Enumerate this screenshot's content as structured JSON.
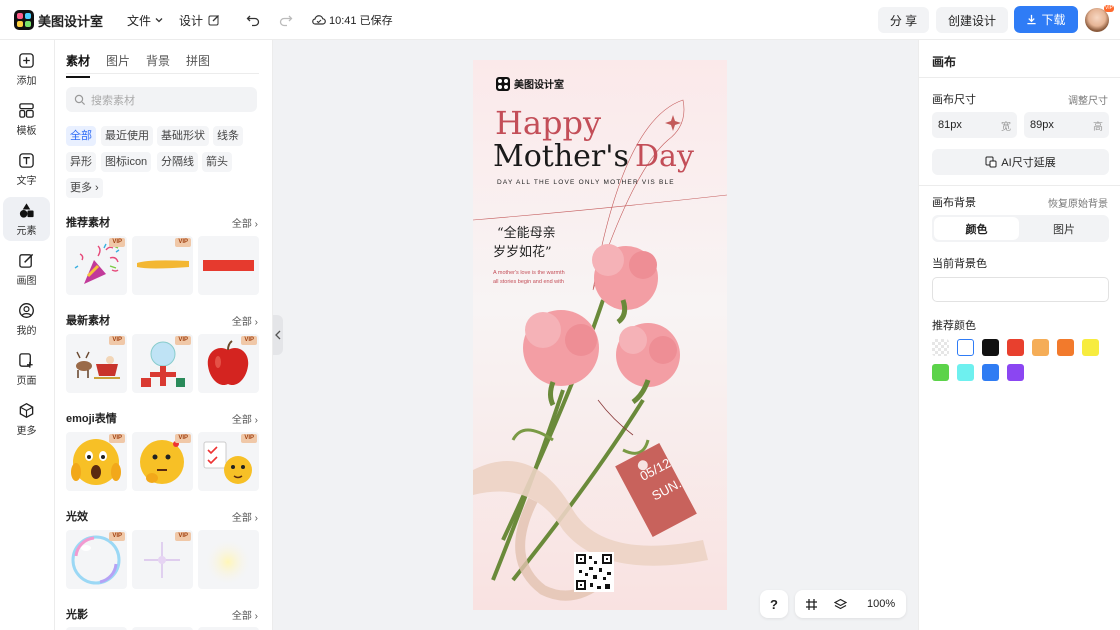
{
  "app": {
    "name": "美图设计室"
  },
  "topbar": {
    "menu_file": "文件",
    "menu_design": "设计",
    "save_status": "10:41 已保存",
    "share_label": "分 享",
    "create_label": "创建设计",
    "download_label": "下载",
    "avatar_badge": "VIP"
  },
  "leftnav": [
    {
      "label": "添加",
      "icon": "plus-square-icon"
    },
    {
      "label": "模板",
      "icon": "template-icon"
    },
    {
      "label": "文字",
      "icon": "text-icon"
    },
    {
      "label": "元素",
      "icon": "shapes-icon"
    },
    {
      "label": "画图",
      "icon": "pen-icon"
    },
    {
      "label": "我的",
      "icon": "user-icon"
    },
    {
      "label": "页面",
      "icon": "page-add-icon"
    },
    {
      "label": "更多",
      "icon": "cube-icon"
    }
  ],
  "panel": {
    "tabs": [
      "素材",
      "图片",
      "背景",
      "拼图"
    ],
    "search_placeholder": "搜索素材",
    "chips": [
      "全部",
      "最近使用",
      "基础形状",
      "线条",
      "异形",
      "图标icon",
      "分隔线",
      "箭头",
      "更多"
    ],
    "all_label": "全部",
    "vip_label": "VIP",
    "sections": [
      {
        "title": "推荐素材"
      },
      {
        "title": "最新素材"
      },
      {
        "title": "emoji表情"
      },
      {
        "title": "光效"
      },
      {
        "title": "光影"
      }
    ]
  },
  "poster": {
    "brand": "美图设计室",
    "happy": "Happy",
    "mother": "Mother's",
    "day": "Day",
    "tagline": "DAY ALL THE LOVE ONLY MOTHER VIS BLE",
    "quote1": "“全能母亲",
    "quote2": "岁岁如花”",
    "small1": "A mother's love is the warmth",
    "small2": "all stories begin and end with",
    "tag_date": "05/12",
    "tag_day": "SUN."
  },
  "right": {
    "title": "画布",
    "size_label": "画布尺寸",
    "adjust_label": "调整尺寸",
    "width_value": "81px",
    "width_unit": "宽",
    "height_value": "89px",
    "height_unit": "高",
    "ai_extend": "AI尺寸延展",
    "bg_label": "画布背景",
    "restore_label": "恢复原始背景",
    "seg_color": "颜色",
    "seg_image": "图片",
    "current_bg_label": "当前背景色",
    "recommend_label": "推荐颜色",
    "swatches": [
      "transparent",
      "#ffffff",
      "#111111",
      "#e8402e",
      "#f5ad57",
      "#f27a2c",
      "#f7ec3f",
      "#5cd34a",
      "#6ef0ef",
      "#2f7cf3",
      "#8b46f2"
    ]
  },
  "bottombar": {
    "help": "?",
    "zoom": "100%"
  }
}
